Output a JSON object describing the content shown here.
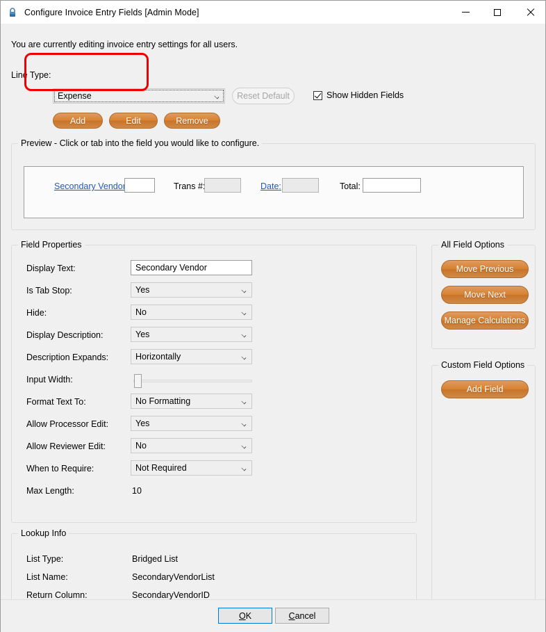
{
  "window": {
    "title": "Configure Invoice Entry Fields [Admin Mode]",
    "icon": "lock-icon",
    "minimize": "–",
    "maximize": "□",
    "close": "✕"
  },
  "header": {
    "info_text": "You are currently editing invoice entry settings for all users.",
    "line_type_label": "Line Type:",
    "line_type_value": "Expense",
    "line_type_options": [
      "Expense"
    ],
    "reset_default_label": "Reset Default",
    "show_hidden_label": "Show Hidden Fields",
    "show_hidden_checked": true,
    "buttons": [
      {
        "id": "add",
        "label": "Add"
      },
      {
        "id": "edit",
        "label": "Edit"
      },
      {
        "id": "remove",
        "label": "Remove"
      }
    ]
  },
  "preview": {
    "legend": "Preview - Click or tab into the field you would like to configure.",
    "fields": [
      {
        "label": "Secondary Vendor:",
        "is_link": true,
        "value": "",
        "disabled": false,
        "selected": true
      },
      {
        "label": "Trans #:",
        "is_link": false,
        "value": "",
        "disabled": true,
        "selected": false
      },
      {
        "label": "Date:",
        "is_link": true,
        "value": "",
        "disabled": true,
        "selected": false
      },
      {
        "label": "Total:",
        "is_link": false,
        "value": "",
        "disabled": false,
        "selected": false
      }
    ]
  },
  "field_properties": {
    "legend": "Field Properties",
    "rows": [
      {
        "label": "Display Text:",
        "type": "text",
        "value": "Secondary Vendor"
      },
      {
        "label": "Is Tab Stop:",
        "type": "combo",
        "value": "Yes"
      },
      {
        "label": "Hide:",
        "type": "combo",
        "value": "No"
      },
      {
        "label": "Display Description:",
        "type": "combo",
        "value": "Yes"
      },
      {
        "label": "Description Expands:",
        "type": "combo",
        "value": "Horizontally"
      },
      {
        "label": "Input Width:",
        "type": "slider",
        "value": "0"
      },
      {
        "label": "Format Text To:",
        "type": "combo",
        "value": "No Formatting"
      },
      {
        "label": "Allow Processor Edit:",
        "type": "combo",
        "value": "Yes"
      },
      {
        "label": "Allow Reviewer Edit:",
        "type": "combo",
        "value": "No"
      },
      {
        "label": "When to Require:",
        "type": "combo",
        "value": "Not Required"
      },
      {
        "label": "Max Length:",
        "type": "static",
        "value": "10"
      }
    ]
  },
  "lookup_info": {
    "legend": "Lookup Info",
    "rows": [
      {
        "label": "List Type:",
        "value": "Bridged List"
      },
      {
        "label": "List Name:",
        "value": "SecondaryVendorList"
      },
      {
        "label": "Return Column:",
        "value": "SecondaryVendorID"
      }
    ]
  },
  "all_field_options": {
    "legend": "All Field Options",
    "buttons": [
      {
        "id": "move-previous",
        "label": "Move Previous"
      },
      {
        "id": "move-next",
        "label": "Move Next"
      },
      {
        "id": "manage-calculations",
        "label": "Manage Calculations"
      }
    ]
  },
  "custom_field_options": {
    "legend": "Custom Field Options",
    "buttons": [
      {
        "id": "add-field",
        "label": "Add Field"
      }
    ]
  },
  "footer": {
    "ok_prefix": "O",
    "ok_rest": "K",
    "cancel_prefix": "C",
    "cancel_rest": "ancel"
  },
  "colors": {
    "accent_orange": "#d8832f",
    "link_blue": "#2156c4",
    "selection_red": "#ee0000",
    "focus_blue": "#0078d7",
    "window_bg": "#f0f0f0"
  }
}
